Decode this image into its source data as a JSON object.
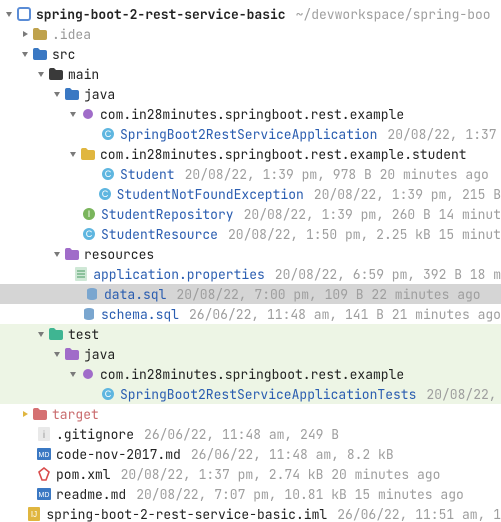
{
  "root": {
    "name": "spring-boot-2-rest-service-basic",
    "path": "~/devworkspace/spring-boo"
  },
  "idea": {
    "name": ".idea"
  },
  "src": {
    "name": "src"
  },
  "main": {
    "name": "main"
  },
  "java_main": {
    "name": "java"
  },
  "pkg_example": {
    "name": "com.in28minutes.springboot.rest.example"
  },
  "app_class": {
    "name": "SpringBoot2RestServiceApplication",
    "meta": "20/08/22, 1:37"
  },
  "pkg_student": {
    "name": "com.in28minutes.springboot.rest.example.student"
  },
  "student": {
    "name": "Student",
    "meta": "20/08/22, 1:39 pm, 978 B 20 minutes ago"
  },
  "student_nfe": {
    "name": "StudentNotFoundException",
    "meta": "20/08/22, 1:39 pm, 215 B"
  },
  "student_repo": {
    "name": "StudentRepository",
    "meta": "20/08/22, 1:39 pm, 260 B 14 minut"
  },
  "student_res": {
    "name": "StudentResource",
    "meta": "20/08/22, 1:50 pm, 2.25 kB 15 minut"
  },
  "resources": {
    "name": "resources"
  },
  "app_props": {
    "name": "application.properties",
    "meta": "20/08/22, 6:59 pm, 392 B 18 m"
  },
  "data_sql": {
    "name": "data.sql",
    "meta": "20/08/22, 7:00 pm, 109 B 22 minutes ago"
  },
  "schema_sql": {
    "name": "schema.sql",
    "meta": "26/06/22, 11:48 am, 141 B 21 minutes ago"
  },
  "test": {
    "name": "test"
  },
  "java_test": {
    "name": "java"
  },
  "pkg_example_test": {
    "name": "com.in28minutes.springboot.rest.example"
  },
  "tests_class": {
    "name": "SpringBoot2RestServiceApplicationTests",
    "meta": "20/08/22,"
  },
  "target": {
    "name": "target"
  },
  "gitignore": {
    "name": ".gitignore",
    "meta": "26/06/22, 11:48 am, 249 B"
  },
  "code_nov": {
    "name": "code-nov-2017.md",
    "meta": "26/06/22, 11:48 am, 8.2 kB"
  },
  "pom": {
    "name": "pom.xml",
    "meta": "20/08/22, 1:37 pm, 2.74 kB 20 minutes ago"
  },
  "readme": {
    "name": "readme.md",
    "meta": "20/08/22, 7:07 pm, 10.81 kB 15 minutes ago"
  },
  "iml": {
    "name": "spring-boot-2-rest-service-basic.iml",
    "meta": "26/06/22, 11:51 am, 1"
  }
}
